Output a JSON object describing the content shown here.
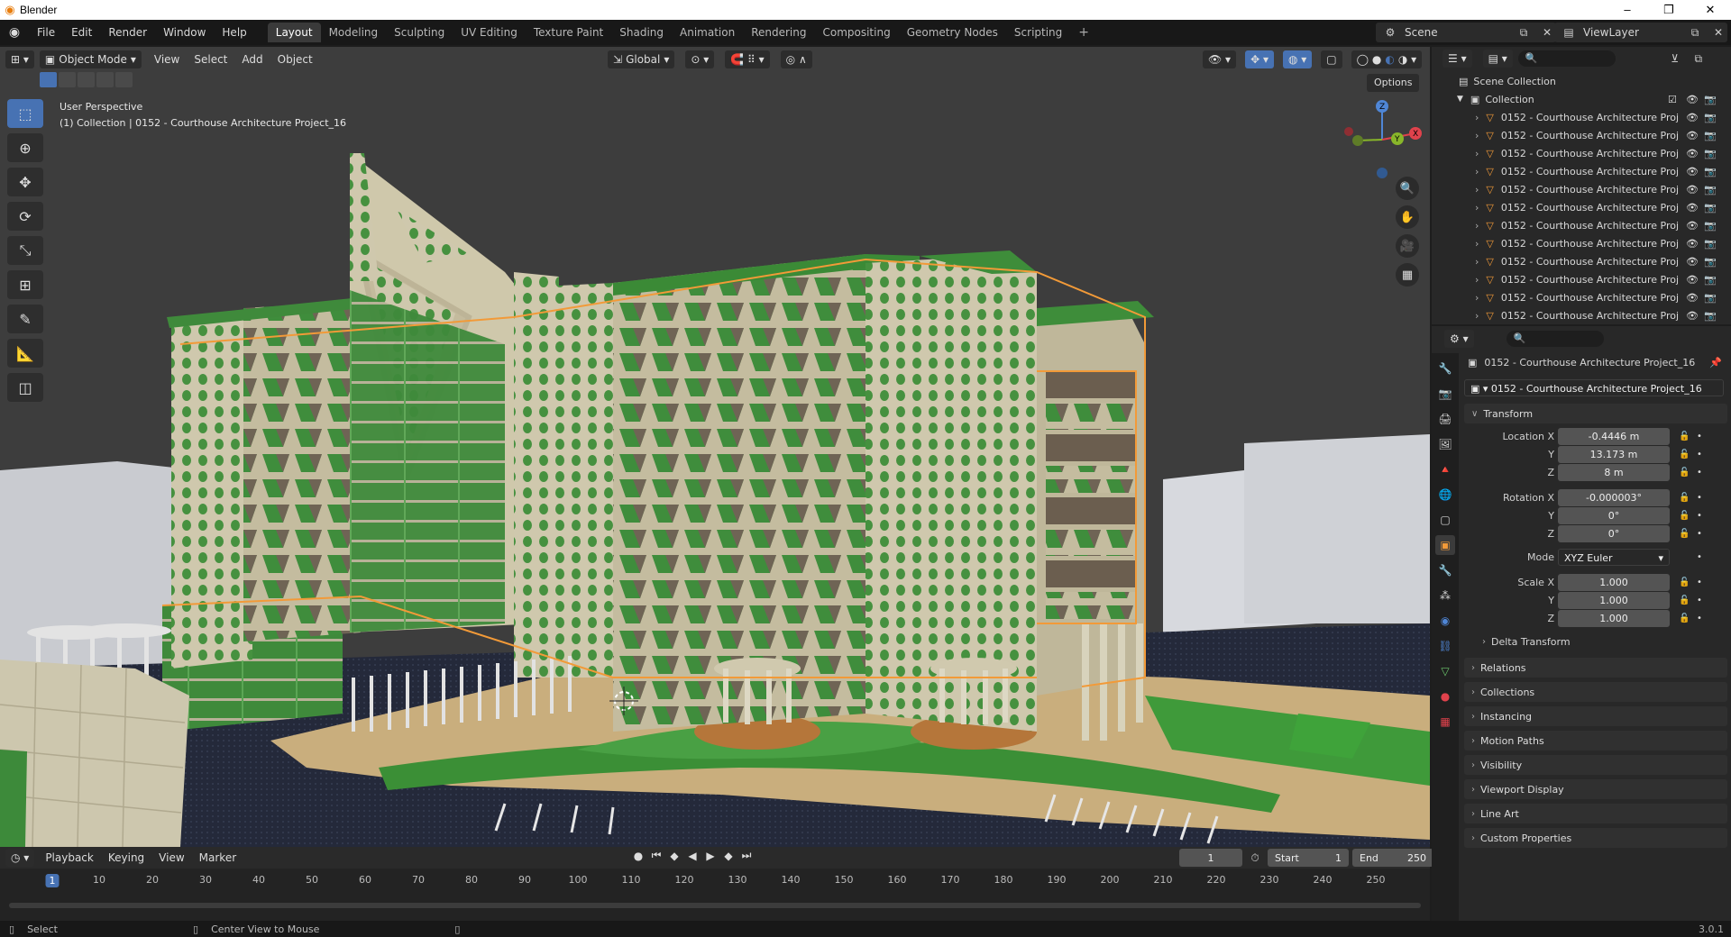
{
  "window": {
    "title": "Blender"
  },
  "menu": [
    "File",
    "Edit",
    "Render",
    "Window",
    "Help"
  ],
  "workspaces": [
    {
      "label": "Layout",
      "active": true
    },
    {
      "label": "Modeling"
    },
    {
      "label": "Sculpting"
    },
    {
      "label": "UV Editing"
    },
    {
      "label": "Texture Paint"
    },
    {
      "label": "Shading"
    },
    {
      "label": "Animation"
    },
    {
      "label": "Rendering"
    },
    {
      "label": "Compositing"
    },
    {
      "label": "Geometry Nodes"
    },
    {
      "label": "Scripting"
    }
  ],
  "scene": {
    "name": "Scene",
    "view_layer": "ViewLayer"
  },
  "viewport": {
    "mode": "Object Mode",
    "menu": [
      "View",
      "Select",
      "Add",
      "Object"
    ],
    "orientation": "Global",
    "options_label": "Options",
    "info_line1": "User Perspective",
    "info_line2": "(1) Collection | 0152 - Courthouse Architecture Project_16"
  },
  "outliner": {
    "root": "Scene Collection",
    "collection": "Collection",
    "objects": [
      "0152 - Courthouse Architecture Proj",
      "0152 - Courthouse Architecture Proj",
      "0152 - Courthouse Architecture Proj",
      "0152 - Courthouse Architecture Proj",
      "0152 - Courthouse Architecture Proj",
      "0152 - Courthouse Architecture Proj",
      "0152 - Courthouse Architecture Proj",
      "0152 - Courthouse Architecture Proj",
      "0152 - Courthouse Architecture Proj",
      "0152 - Courthouse Architecture Proj",
      "0152 - Courthouse Architecture Proj",
      "0152 - Courthouse Architecture Proj"
    ]
  },
  "properties": {
    "object_name": "0152 - Courthouse Architecture Project_16",
    "object_field": "0152 - Courthouse Architecture Project_16",
    "transform_label": "Transform",
    "location": {
      "label": "Location X",
      "x": "-0.4446 m",
      "y": "13.173 m",
      "z": "8 m"
    },
    "rotation": {
      "label": "Rotation X",
      "x": "-0.000003°",
      "y": "0°",
      "z": "0°"
    },
    "mode_label": "Mode",
    "mode_value": "XYZ Euler",
    "scale": {
      "label": "Scale X",
      "x": "1.000",
      "y": "1.000",
      "z": "1.000"
    },
    "axis_y": "Y",
    "axis_z": "Z",
    "delta": "Delta Transform",
    "panels": [
      "Relations",
      "Collections",
      "Instancing",
      "Motion Paths",
      "Visibility",
      "Viewport Display",
      "Line Art",
      "Custom Properties"
    ]
  },
  "timeline": {
    "menu": [
      "Playback",
      "Keying",
      "View",
      "Marker"
    ],
    "current_frame": "1",
    "start_label": "Start",
    "start": "1",
    "end_label": "End",
    "end": "250",
    "ticks": [
      "10",
      "20",
      "30",
      "40",
      "50",
      "60",
      "70",
      "80",
      "90",
      "100",
      "110",
      "120",
      "130",
      "140",
      "150",
      "160",
      "170",
      "180",
      "190",
      "200",
      "210",
      "220",
      "230",
      "240",
      "250"
    ]
  },
  "status": {
    "select": "Select",
    "center": "Center View to Mouse",
    "version": "3.0.1"
  },
  "colors": {
    "accent": "#4772b3",
    "selection": "#f29a38",
    "facade": "#c7c0a4",
    "green": "#3d8a3a"
  }
}
